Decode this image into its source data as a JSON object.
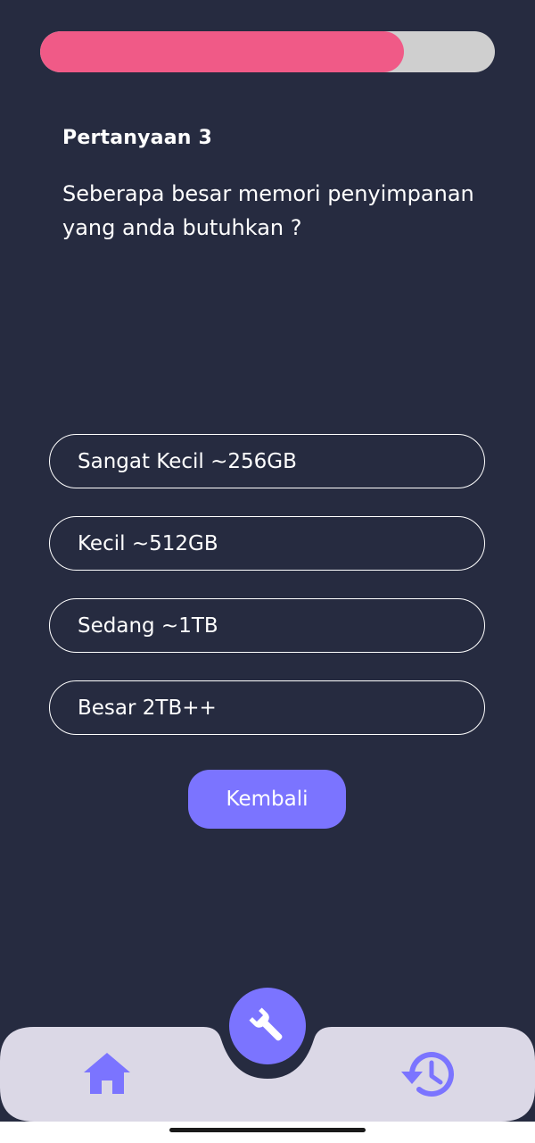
{
  "progress": {
    "value_percent": 80,
    "fill_color": "#f05a87",
    "track_color": "#cfcfcf"
  },
  "question": {
    "number_label": "Pertanyaan 3",
    "text": "Seberapa besar memori penyimpanan yang anda butuhkan ?"
  },
  "answers": [
    {
      "label": "Sangat Kecil ~256GB"
    },
    {
      "label": "Kecil ~512GB"
    },
    {
      "label": "Sedang ~1TB"
    },
    {
      "label": "Besar 2TB++"
    }
  ],
  "back_button": {
    "label": "Kembali",
    "color": "#7b74ff"
  },
  "bottom_nav": {
    "items": [
      {
        "icon": "home-icon"
      },
      {
        "icon": "wrench-icon"
      },
      {
        "icon": "history-icon"
      }
    ],
    "bar_color": "#dbd8e6",
    "accent_color": "#7b74ff"
  },
  "colors": {
    "background": "#262b40"
  }
}
